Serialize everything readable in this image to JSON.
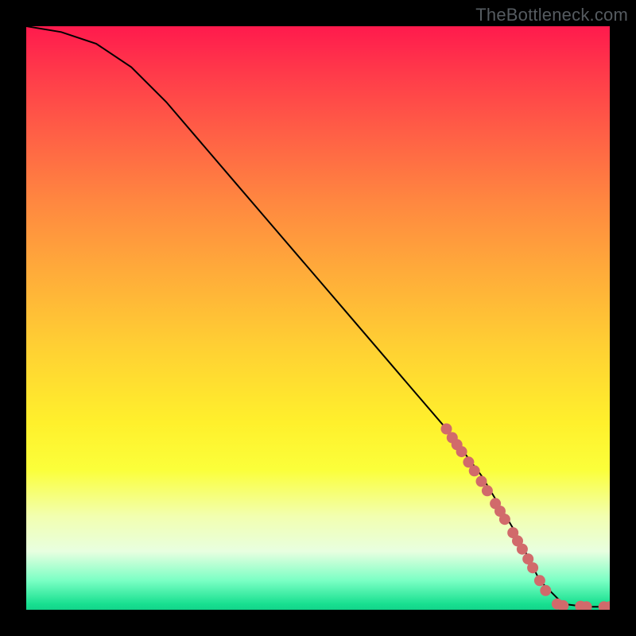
{
  "watermark": "TheBottleneck.com",
  "chart_data": {
    "type": "line",
    "title": "",
    "xlabel": "",
    "ylabel": "",
    "xlim": [
      0,
      100
    ],
    "ylim": [
      0,
      100
    ],
    "series": [
      {
        "name": "curve",
        "x": [
          0,
          6,
          12,
          18,
          24,
          30,
          36,
          42,
          48,
          54,
          60,
          66,
          72,
          78,
          84,
          88,
          92,
          96,
          100
        ],
        "y": [
          100,
          99,
          97,
          93,
          87,
          80,
          73,
          66,
          59,
          52,
          45,
          38,
          31,
          23,
          13,
          5,
          1,
          0.5,
          0.5
        ]
      }
    ],
    "markers": [
      {
        "x": 72.0,
        "y": 31.0
      },
      {
        "x": 73.0,
        "y": 29.5
      },
      {
        "x": 73.8,
        "y": 28.3
      },
      {
        "x": 74.6,
        "y": 27.1
      },
      {
        "x": 75.8,
        "y": 25.3
      },
      {
        "x": 76.8,
        "y": 23.8
      },
      {
        "x": 78.0,
        "y": 22.0
      },
      {
        "x": 79.0,
        "y": 20.4
      },
      {
        "x": 80.4,
        "y": 18.2
      },
      {
        "x": 81.2,
        "y": 16.9
      },
      {
        "x": 82.0,
        "y": 15.5
      },
      {
        "x": 83.4,
        "y": 13.2
      },
      {
        "x": 84.2,
        "y": 11.8
      },
      {
        "x": 85.0,
        "y": 10.4
      },
      {
        "x": 86.0,
        "y": 8.7
      },
      {
        "x": 86.8,
        "y": 7.2
      },
      {
        "x": 88.0,
        "y": 5.0
      },
      {
        "x": 89.0,
        "y": 3.3
      },
      {
        "x": 91.0,
        "y": 1.0
      },
      {
        "x": 92.0,
        "y": 0.7
      },
      {
        "x": 95.0,
        "y": 0.6
      },
      {
        "x": 96.0,
        "y": 0.5
      },
      {
        "x": 99.0,
        "y": 0.5
      },
      {
        "x": 100.0,
        "y": 0.5
      }
    ],
    "marker_color": "#d16a6b",
    "marker_radius_px": 7
  }
}
